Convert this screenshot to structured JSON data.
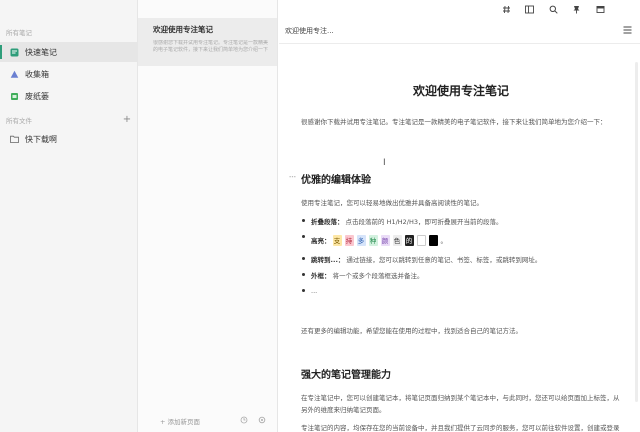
{
  "sidebar": {
    "section_notebooks": "所有笔记",
    "items": [
      {
        "label": "快速笔记",
        "icon": "quick-note-icon",
        "color": "#2e9d7a"
      },
      {
        "label": "收集箱",
        "icon": "inbox-icon",
        "color": "#6a7fd1"
      },
      {
        "label": "废纸篓",
        "icon": "trash-icon",
        "color": "#3fae5a"
      }
    ],
    "section_files": "所有文件",
    "folders": [
      {
        "label": "快下载啊",
        "icon": "folder-icon"
      }
    ],
    "add_label": "+"
  },
  "note_list": {
    "card": {
      "title": "欢迎使用专注笔记",
      "preview": "很感谢您下载并试用专注笔记。专注笔记是一款精美的电子笔记软件，接下来让我们简单地为您介绍一下"
    },
    "new_page_label": "+ 添加新页面"
  },
  "toolbar": {
    "icons": [
      "hash-icon",
      "layout-icon",
      "search-icon",
      "pin-icon",
      "window-icon"
    ]
  },
  "editor": {
    "header_title": "欢迎使用专注...",
    "doc": {
      "title": "欢迎使用专注笔记",
      "intro": "很感谢你下载并试用专注笔记。专注笔记是一款精美的电子笔记软件，接下来让我们简单地为您介绍一下：",
      "section1": {
        "heading": "优雅的编辑体验",
        "lead": "使用专注笔记，您可以轻易地做出优雅并具备高阅读性的笔记。",
        "bullets": [
          {
            "key": "折叠段落：",
            "text": "点击段落前的 H1/H2/H3，即可折叠展开当前的段落。"
          },
          {
            "key": "高亮：",
            "text": "。"
          },
          {
            "key": "跳转到...：",
            "text": "通过链接，您可以跳转到任意的笔记、书签、标签，或跳转到网址。"
          },
          {
            "key": "外框：",
            "text": "将一个或多个段落框选并备注。"
          },
          {
            "key": "",
            "text": "..."
          }
        ],
        "highlights": [
          {
            "char": "支",
            "bg": "#fde7a6",
            "fg": "#7a5a00"
          },
          {
            "char": "持",
            "bg": "#fbc7cf",
            "fg": "#b0263d"
          },
          {
            "char": "多",
            "bg": "#d6e4fa",
            "fg": "#2d5fb0"
          },
          {
            "char": "种",
            "bg": "#d3f1df",
            "fg": "#238a4c"
          },
          {
            "char": "颜",
            "bg": "#eadcf7",
            "fg": "#7240a8"
          },
          {
            "char": "色",
            "bg": "#ededed",
            "fg": "#333333"
          },
          {
            "char": "的",
            "bg": "#222222",
            "fg": "#ffffff"
          },
          {
            "char": "",
            "bg": "#ffffff",
            "fg": "#333333"
          },
          {
            "char": "",
            "bg": "#000000",
            "fg": "#ffffff"
          }
        ],
        "outro": "还有更多的编辑功能，希望您能在使用的过程中，找到适合自己的笔记方法。"
      },
      "section2": {
        "heading": "强大的笔记管理能力",
        "p1": "在专注笔记中，您可以创建笔记本，将笔记页面归纳到某个笔记本中，与此同时，您还可以给页面加上标签，从另外的维度来归纳笔记页面。",
        "p2": "专注笔记的内容，均保存在您的当前设备中，并且我们提供了云同步的服务，您可以前往软件设置，创建或登录您的 Focus 账号，打开并进行同步。"
      }
    }
  },
  "colors": {
    "accent": "#2e9d7a",
    "sidebar_bg": "#f5f5f5",
    "selected_bg": "#e6e6e6"
  }
}
